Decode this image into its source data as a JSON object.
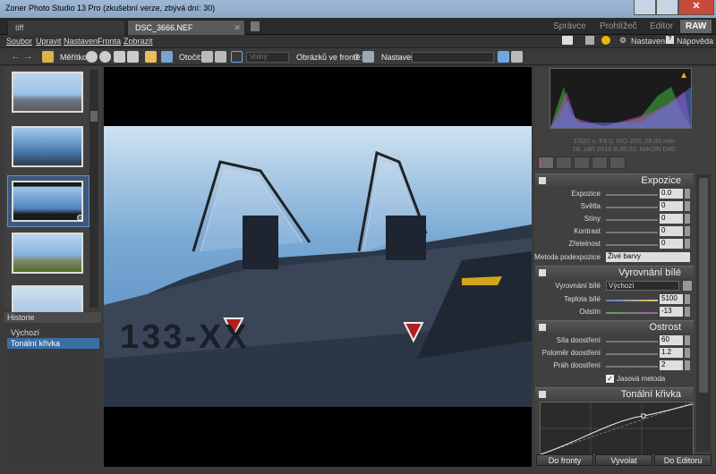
{
  "window": {
    "title": "Zoner Photo Studio 13 Pro (zkušební verze, zbývá dní: 30)"
  },
  "tabs": [
    {
      "label": "tiff"
    },
    {
      "label": "DSC_3666.NEF"
    }
  ],
  "modes": {
    "spravce": "Správce",
    "prohlizec": "Prohlížeč",
    "editor": "Editor",
    "raw": "RAW"
  },
  "menu": {
    "items": [
      "Soubor",
      "Upravit",
      "Nastavení",
      "Fronta",
      "Zobrazit"
    ],
    "nastaveni": "Nastavení",
    "napoveda": "Nápověda"
  },
  "toolbar": {
    "meritko": "Měřítko:",
    "otocit": "Otočit:",
    "volny": "Volný",
    "queue_label": "Obrázků ve frontě:",
    "queue_count": "0",
    "nastaveni": "Nastavení:"
  },
  "history": {
    "title": "Historie",
    "items": [
      "Výchozí",
      "Tonální křivka"
    ]
  },
  "exif": {
    "line1": "1/320 s, F9.0, ISO 200, 28.00 mm",
    "line2": "18. září 2010 8:35:20, NIKON D40"
  },
  "image": {
    "text": "133-XX"
  },
  "expozice": {
    "title": "Expozice",
    "rows": [
      {
        "label": "Expozice",
        "value": "0.0"
      },
      {
        "label": "Světla",
        "value": "0"
      },
      {
        "label": "Stíny",
        "value": "0"
      },
      {
        "label": "Kontrast",
        "value": "0"
      },
      {
        "label": "Zřetelnost",
        "value": "0"
      }
    ],
    "method_label": "Metoda podexpozice",
    "method_value": "Živé barvy"
  },
  "wb": {
    "title": "Vyrovnání bílé",
    "mode_label": "Vyrovnání bílé",
    "mode_value": "Výchozí",
    "rows": [
      {
        "label": "Teplota bílé",
        "value": "5100"
      },
      {
        "label": "Odstín",
        "value": "-13"
      }
    ]
  },
  "sharp": {
    "title": "Ostrost",
    "rows": [
      {
        "label": "Síla doostření",
        "value": "60"
      },
      {
        "label": "Poloměr doostření",
        "value": "1.2"
      },
      {
        "label": "Práh doostření",
        "value": "2"
      }
    ],
    "jasova": "Jasová metoda"
  },
  "tonal": {
    "title": "Tonální křivka"
  },
  "buttons": {
    "fronta": "Do fronty",
    "vyvolat": "Vyvolat",
    "editor": "Do Editoru"
  },
  "colors": {
    "accent": "#3b6ea5",
    "warning": "#e8b800"
  }
}
